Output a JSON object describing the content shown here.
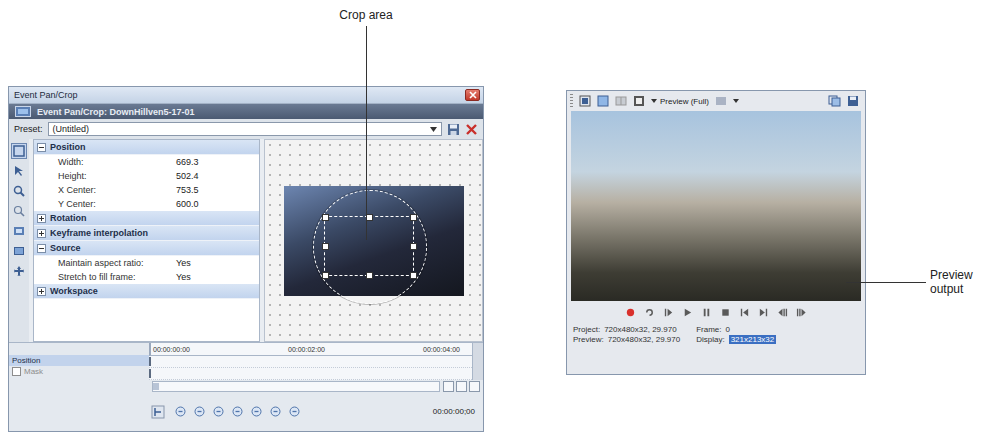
{
  "callouts": [
    {
      "label": "Crop area"
    },
    {
      "label": "Preview output"
    }
  ],
  "pan_crop_window": {
    "title": "Event Pan/Crop",
    "header": "Event Pan/Crop: DownHillven5-17-01",
    "preset": {
      "label": "Preset:",
      "value": "(Untitled)"
    },
    "toolbar": [
      {
        "selected": true
      },
      {
        "selected": false
      },
      {
        "selected": false
      },
      {
        "selected": false
      },
      {
        "selected": false
      },
      {
        "selected": false
      },
      {
        "selected": false
      }
    ],
    "sections": [
      {
        "title": "Position",
        "expanded": true,
        "rows": [
          {
            "label": "Width:",
            "value": "669.3"
          },
          {
            "label": "Height:",
            "value": "502.4"
          },
          {
            "label": "X Center:",
            "value": "753.5"
          },
          {
            "label": "Y Center:",
            "value": "600.0"
          }
        ]
      },
      {
        "title": "Rotation",
        "expanded": false,
        "rows": []
      },
      {
        "title": "Keyframe interpolation",
        "expanded": false,
        "rows": []
      },
      {
        "title": "Source",
        "expanded": true,
        "rows": [
          {
            "label": "Maintain aspect ratio:",
            "value": "Yes"
          },
          {
            "label": "Stretch to fill frame:",
            "value": "Yes"
          }
        ]
      },
      {
        "title": "Workspace",
        "expanded": false,
        "rows": []
      }
    ],
    "timeline": {
      "ticks": [
        "00:00:00:00",
        "00:00:02:00",
        "00:00:04:00"
      ],
      "tracks": [
        {
          "label": "Position",
          "kind": "plain",
          "selected": true,
          "disabled": false
        },
        {
          "label": "Mask",
          "kind": "checkbox",
          "checked": false,
          "selected": false,
          "disabled": true
        }
      ],
      "time": "00:00:00;00"
    }
  },
  "preview_window": {
    "mode": "Preview (Full)",
    "status": [
      {
        "label": "Project:",
        "value": "720x480x32, 29.970",
        "highlighted": false
      },
      {
        "label": "Frame:",
        "value": "0",
        "highlighted": false
      },
      {
        "label": "Preview:",
        "value": "720x480x32, 29.970",
        "highlighted": false
      },
      {
        "label": "Display:",
        "value": "321x213x32",
        "highlighted": true
      }
    ]
  }
}
